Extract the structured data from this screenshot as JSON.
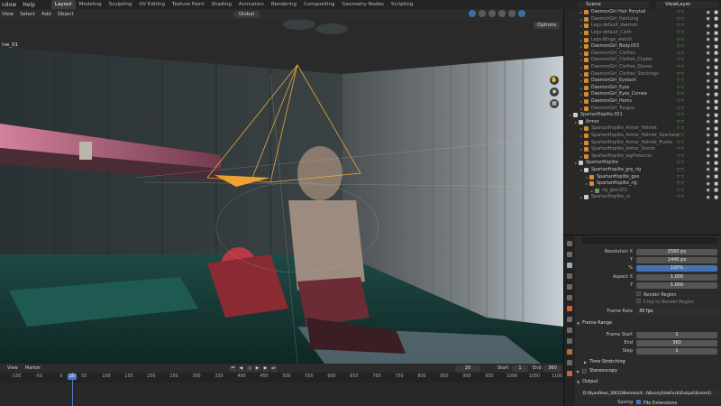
{
  "topbar": {
    "menu": [
      "ndow",
      "Help"
    ],
    "tabs": [
      "Layout",
      "Modeling",
      "Sculpting",
      "UV Editing",
      "Texture Paint",
      "Shading",
      "Animation",
      "Rendering",
      "Compositing",
      "Geometry Nodes",
      "Scripting"
    ],
    "active_tab": "Layout",
    "scene": "Scene",
    "view_layer": "ViewLayer"
  },
  "viewport_header": {
    "items": [
      "View",
      "Select",
      "Add",
      "Object"
    ],
    "transform": "Global"
  },
  "viewport": {
    "camera_label": "ine_01",
    "options": "Options"
  },
  "outliner": {
    "rows": [
      {
        "label": "DaemonGirl Hair Ponytail",
        "indent": 2,
        "icon": "orange",
        "dim": false
      },
      {
        "label": "DaemonGirl_HairLong",
        "indent": 2,
        "icon": "orange",
        "dim": true
      },
      {
        "label": "Legs-default_daemon",
        "indent": 2,
        "icon": "orange",
        "dim": true
      },
      {
        "label": "Legs-default_Cloth",
        "indent": 2,
        "icon": "orange",
        "dim": true
      },
      {
        "label": "Legs-Wings_sketch",
        "indent": 2,
        "icon": "orange",
        "dim": true
      },
      {
        "label": "DaemonGirl_Body.003",
        "indent": 2,
        "icon": "orange",
        "dim": false
      },
      {
        "label": "DaemonGirl_Clothes",
        "indent": 2,
        "icon": "orange",
        "dim": true
      },
      {
        "label": "DaemonGirl_Clothes_Choker",
        "indent": 2,
        "icon": "orange",
        "dim": true
      },
      {
        "label": "DaemonGirl_Clothes_Gloves",
        "indent": 2,
        "icon": "orange",
        "dim": true
      },
      {
        "label": "DaemonGirl_Clothes_Stockings",
        "indent": 2,
        "icon": "orange",
        "dim": true
      },
      {
        "label": "DaemonGirl_Eyelash",
        "indent": 2,
        "icon": "orange",
        "dim": false
      },
      {
        "label": "DaemonGirl_Eyes",
        "indent": 2,
        "icon": "orange",
        "dim": false
      },
      {
        "label": "DaemonGirl_Eyes_Cornea",
        "indent": 2,
        "icon": "orange",
        "dim": false
      },
      {
        "label": "DaemonGirl_Horns",
        "indent": 2,
        "icon": "orange",
        "dim": false
      },
      {
        "label": "DaemonGirl_Tongue",
        "indent": 2,
        "icon": "orange",
        "dim": true
      },
      {
        "label": "SpartanHoplite.001",
        "indent": 0,
        "icon": "white",
        "dim": false
      },
      {
        "label": "Armor",
        "indent": 1,
        "icon": "white",
        "dim": false
      },
      {
        "label": "SpartanHoplite_Armor_Helmet",
        "indent": 2,
        "icon": "orange",
        "dim": true
      },
      {
        "label": "SpartanHoplite_Armor_Helmet_Spartana",
        "indent": 2,
        "icon": "orange",
        "dim": true
      },
      {
        "label": "SpartanHoplite_Armor_Helmet_Plume",
        "indent": 2,
        "icon": "orange",
        "dim": true
      },
      {
        "label": "SpartanHoplite_Armor_Shorts",
        "indent": 2,
        "icon": "orange",
        "dim": true
      },
      {
        "label": "SpartanHoplite_legProtector",
        "indent": 2,
        "icon": "orange",
        "dim": true
      },
      {
        "label": "SpartanHoplite",
        "indent": 1,
        "icon": "white",
        "dim": false
      },
      {
        "label": "SpartanHoplite_grp_rig",
        "indent": 2,
        "icon": "white",
        "dim": false
      },
      {
        "label": "SpartanHoplite_geo",
        "indent": 3,
        "icon": "orange",
        "dim": false
      },
      {
        "label": "SpartanHoplite_rig",
        "indent": 3,
        "icon": "orange",
        "dim": false
      },
      {
        "label": "rig_geo.001",
        "indent": 4,
        "icon": "green",
        "dim": true
      },
      {
        "label": "SpartanHoplite_cs",
        "indent": 2,
        "icon": "white",
        "dim": true
      }
    ]
  },
  "properties": {
    "resolution_x_label": "Resolution X",
    "resolution_x": "2560 px",
    "y_label": "Y",
    "resolution_y": "1440 px",
    "percent_label": "%",
    "percent": "100%",
    "aspect_x_label": "Aspect X",
    "aspect_x": "1.000",
    "aspect_y_label": "Y",
    "aspect_y": "1.000",
    "render_region": "Render Region",
    "crop_region": "Crop to Render Region",
    "frame_rate_label": "Frame Rate",
    "frame_rate": "30 fps",
    "frame_range": "Frame Range",
    "frame_start_label": "Frame Start",
    "frame_start": "1",
    "end_label": "End",
    "end": "360",
    "step_label": "Step",
    "step": "1",
    "time_stretching": "Time Stretching",
    "stereoscopy": "Stereoscopy",
    "output": "Output",
    "output_path": "D:\\RyanReos_3DCG\\Nemesis\\f...t\\BunnySideFuck\\Output\\Scene1\\",
    "saving_label": "Saving",
    "file_extensions": "File Extensions"
  },
  "timeline": {
    "header": [
      "View",
      "Marker"
    ],
    "current_frame": "20",
    "frame_field": "20",
    "start_label": "Start",
    "start": "1",
    "end_label": "End",
    "end": "360",
    "ticks": [
      "-100",
      "-50",
      "0",
      "50",
      "100",
      "150",
      "200",
      "250",
      "300",
      "350",
      "400",
      "450",
      "500",
      "550",
      "600",
      "650",
      "700",
      "750",
      "800",
      "850",
      "900",
      "950",
      "1000",
      "1050",
      "1100"
    ]
  }
}
